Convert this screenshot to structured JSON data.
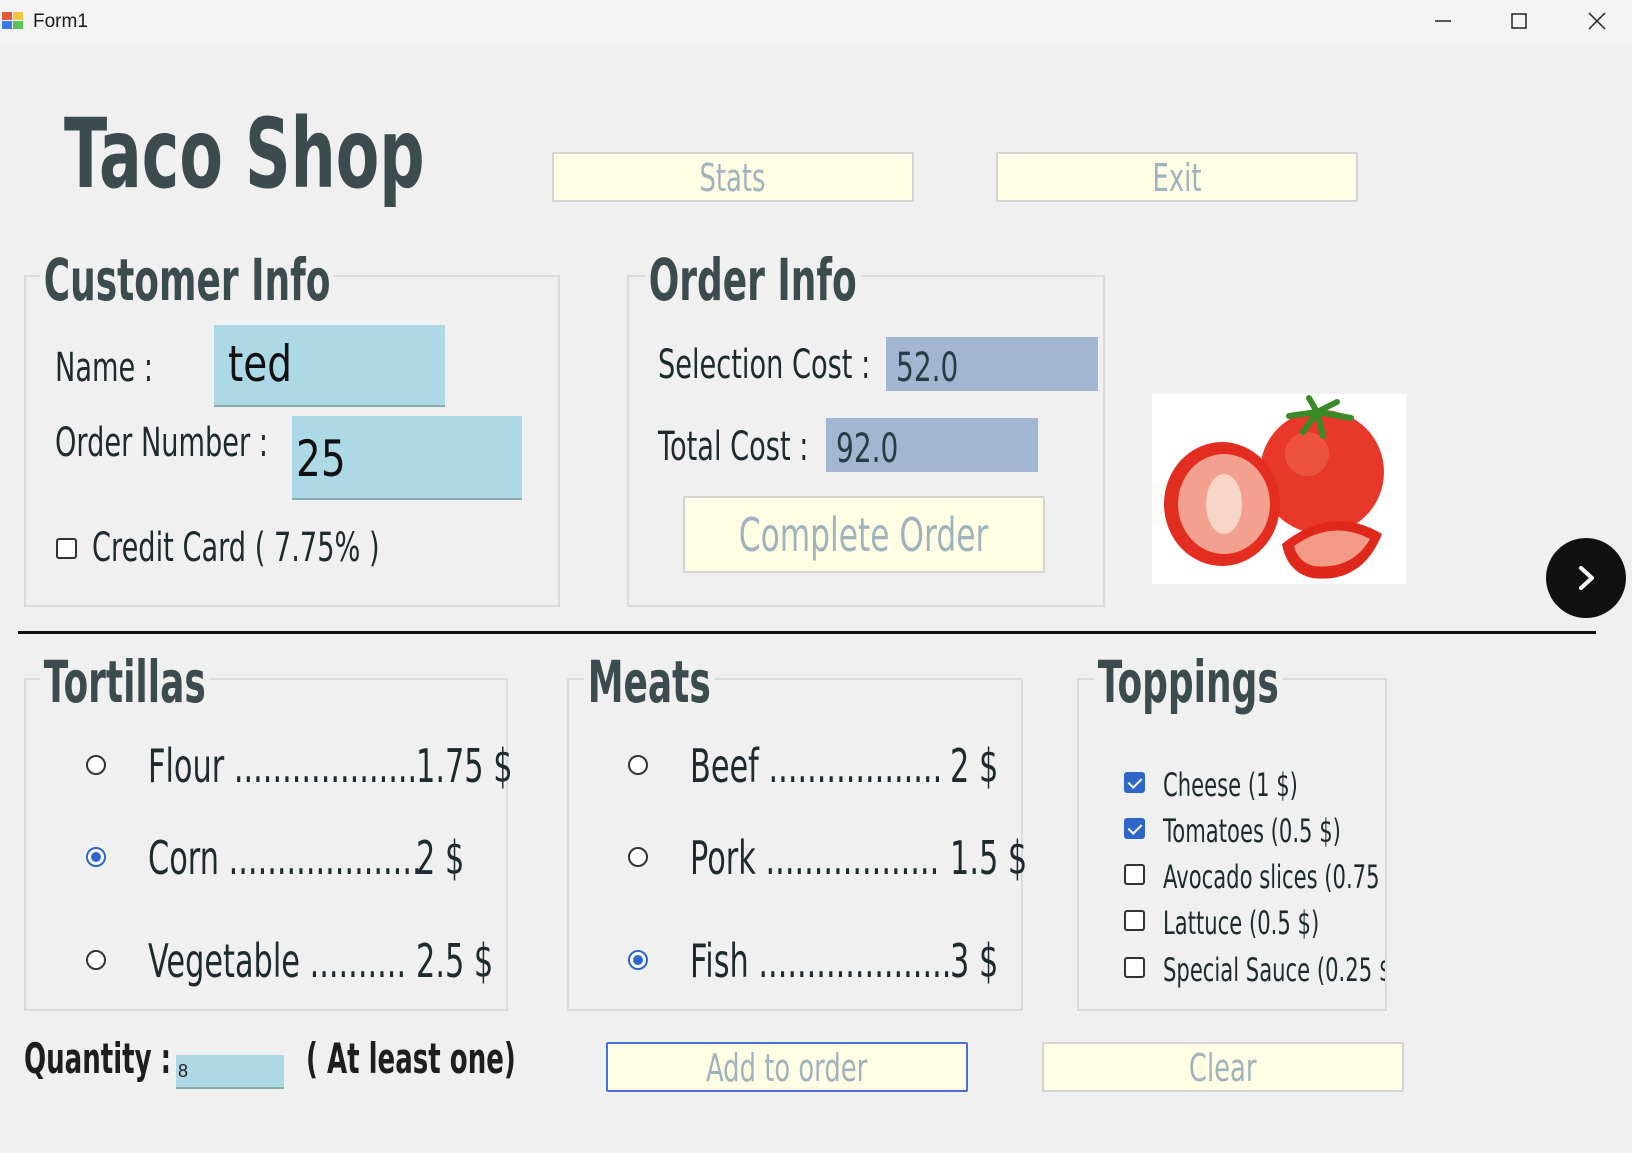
{
  "window": {
    "title": "Form1"
  },
  "header": {
    "title": "Taco Shop",
    "stats_label": "Stats",
    "exit_label": "Exit"
  },
  "customer": {
    "title": "Customer Info",
    "name_label": "Name :",
    "name_value": "ted",
    "order_number_label": "Order Number :",
    "order_number_value": "25",
    "credit_card_label": "Credit Card ( 7.75% )",
    "credit_card_checked": false
  },
  "order": {
    "title": "Order Info",
    "selection_cost_label": "Selection Cost :",
    "selection_cost_value": "52.0",
    "total_cost_label": "Total Cost :",
    "total_cost_value": "92.0",
    "complete_label": "Complete Order"
  },
  "tortillas": {
    "title": "Tortillas",
    "items": [
      {
        "label": "Flour ...................",
        "price": "1.75 $",
        "selected": false
      },
      {
        "label": "Corn ....................",
        "price": "2 $",
        "selected": true
      },
      {
        "label": "Vegetable ..........",
        "price": "2.5 $",
        "selected": false
      }
    ]
  },
  "meats": {
    "title": "Meats",
    "items": [
      {
        "label": "Beef ..................",
        "price": "2 $",
        "selected": false
      },
      {
        "label": "Pork ..................",
        "price": "1.5 $",
        "selected": false
      },
      {
        "label": "Fish ....................",
        "price": "3 $",
        "selected": true
      }
    ]
  },
  "toppings": {
    "title": "Toppings",
    "items": [
      {
        "label": "Cheese  (1 $)",
        "checked": true
      },
      {
        "label": "Tomatoes  (0.5 $)",
        "checked": true
      },
      {
        "label": "Avocado slices  (0.75",
        "checked": false
      },
      {
        "label": "Lattuce  (0.5 $)",
        "checked": false
      },
      {
        "label": "Special Sauce (0.25 $",
        "checked": false
      }
    ]
  },
  "quantity": {
    "label": "Quantity :",
    "value": "8",
    "hint": "( At least one)"
  },
  "actions": {
    "add_label": "Add to order",
    "clear_label": "Clear"
  },
  "icons": {
    "next": "chevron-right-icon",
    "app": "app-icon"
  },
  "colors": {
    "field": "#add8e6",
    "cost_field": "#a3b6d1",
    "button_bg": "#fffde4",
    "accent": "#2f67c9"
  }
}
